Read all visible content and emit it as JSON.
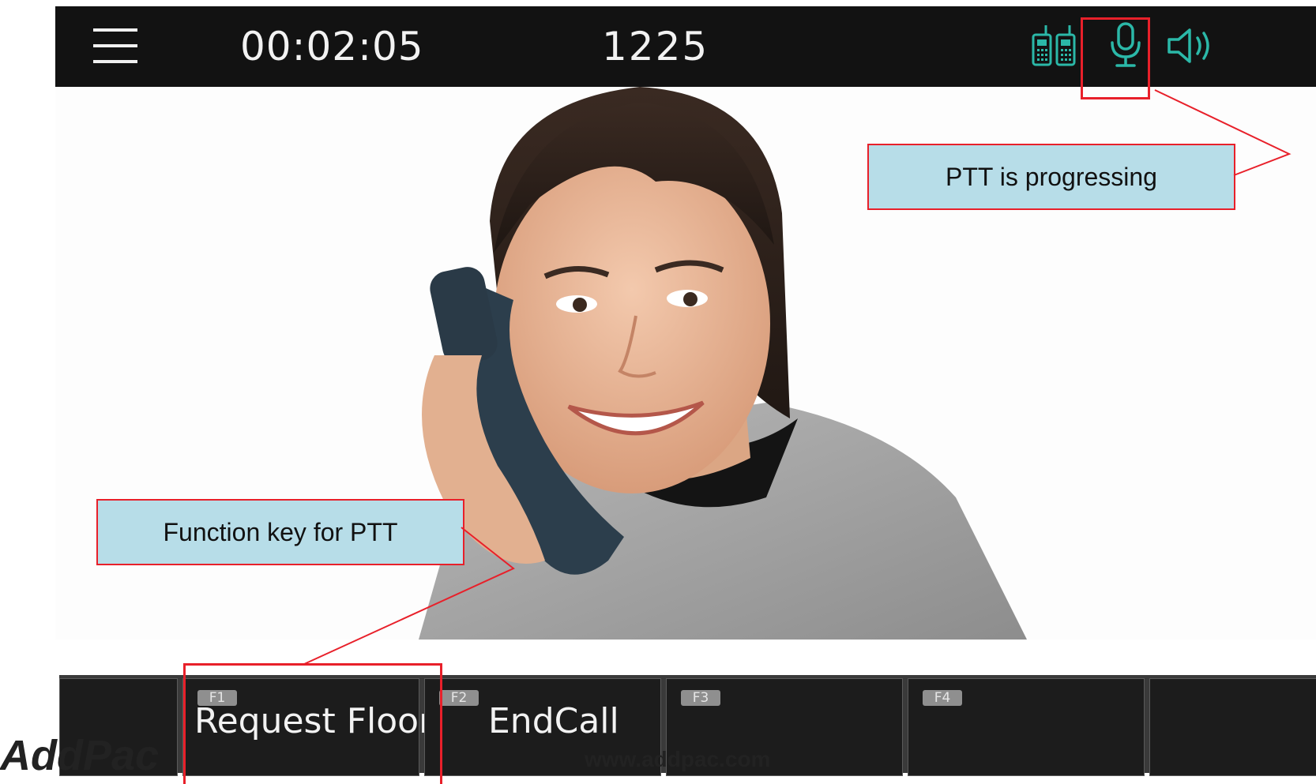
{
  "header": {
    "timer": "00:02:05",
    "number": "1225",
    "icons": [
      "menu-icon",
      "walkie-talkie-icon",
      "microphone-icon",
      "speaker-icon"
    ]
  },
  "callouts": {
    "ptt_status": "PTT is progressing",
    "function_key": "Function key for PTT"
  },
  "softkeys": [
    {
      "key": "",
      "label": ""
    },
    {
      "key": "F1",
      "label": "Request Floor"
    },
    {
      "key": "F2",
      "label": "EndCall"
    },
    {
      "key": "F3",
      "label": ""
    },
    {
      "key": "F4",
      "label": ""
    },
    {
      "key": "",
      "label": ""
    }
  ],
  "footer": {
    "logo": "AddPac",
    "url": "www.addpac.com"
  },
  "colors": {
    "accent": "#2bb8a8",
    "callout_bg": "#b7dde8",
    "callout_border": "#e8202a",
    "topbar": "#121212"
  }
}
